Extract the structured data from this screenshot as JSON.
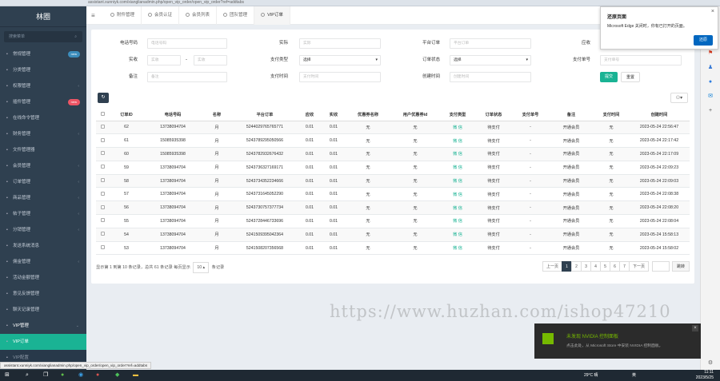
{
  "browser": {
    "address": "assistant.xunniyk.com/xianglianadmin.php/open_vip_order/open_vip_order?ref=addtabs"
  },
  "sidebar": {
    "brand": "林圈",
    "search_placeholder": "搜索菜单",
    "items": [
      {
        "label": "常规管理",
        "badge": "new",
        "badge_color": "#3c8dbc",
        "chev": ""
      },
      {
        "label": "分类管理",
        "badge": "",
        "chev": ""
      },
      {
        "label": "权限管理",
        "badge": "",
        "chev": "‹"
      },
      {
        "label": "插件管理",
        "badge": "new",
        "badge_color": "#ed5565",
        "chev": ""
      },
      {
        "label": "在线命令管理",
        "badge": "",
        "chev": ""
      },
      {
        "label": "财务管理",
        "badge": "",
        "chev": "‹"
      },
      {
        "label": "文件管理器",
        "badge": "",
        "chev": ""
      },
      {
        "label": "会员管理",
        "badge": "",
        "chev": "‹"
      },
      {
        "label": "订单管理",
        "badge": "",
        "chev": "‹"
      },
      {
        "label": "商品管理",
        "badge": "",
        "chev": "‹"
      },
      {
        "label": "帖子管理",
        "badge": "",
        "chev": "‹"
      },
      {
        "label": "分销管理",
        "badge": "",
        "chev": "‹"
      },
      {
        "label": "发送系统消息",
        "badge": "",
        "chev": ""
      },
      {
        "label": "佣金管理",
        "badge": "",
        "chev": "‹"
      },
      {
        "label": "活动金额管理",
        "badge": "",
        "chev": ""
      },
      {
        "label": "意见反馈管理",
        "badge": "",
        "chev": ""
      },
      {
        "label": "聊天记录管理",
        "badge": "",
        "chev": ""
      },
      {
        "label": "VIP管理",
        "badge": "",
        "chev": "⌄",
        "state": "open"
      },
      {
        "label": "VIP订单",
        "badge": "",
        "chev": "",
        "state": "active"
      },
      {
        "label": "VIP配置",
        "badge": "",
        "chev": "",
        "state": "sub"
      }
    ]
  },
  "tabs": [
    {
      "label": "附件管理",
      "active": false
    },
    {
      "label": "会员认证",
      "active": false
    },
    {
      "label": "会员列表",
      "active": false
    },
    {
      "label": "团队管理",
      "active": false
    },
    {
      "label": "VIP订单",
      "active": true
    }
  ],
  "filters": {
    "phone": {
      "label": "电话号码",
      "placeholder": "电话号码"
    },
    "price": {
      "label": "实际",
      "placeholder": "实际"
    },
    "platform_order": {
      "label": "平台订单",
      "placeholder": "平台订单"
    },
    "amount": {
      "label": "应收",
      "placeholder": "应收"
    },
    "paid": {
      "label": "实收",
      "placeholder_from": "实收",
      "placeholder_to": "实收",
      "sep": "-"
    },
    "pay_type": {
      "label": "支付类型",
      "value": "选择"
    },
    "order_status": {
      "label": "订单状态",
      "value": "选择"
    },
    "pay_no": {
      "label": "支付单号",
      "placeholder": "支付单号"
    },
    "remark": {
      "label": "备注",
      "placeholder": "备注"
    },
    "pay_time": {
      "label": "支付时间",
      "placeholder": "支付时间"
    },
    "create_time": {
      "label": "创建时间",
      "placeholder": "创建时间"
    },
    "submit": "提交",
    "reset": "重置"
  },
  "table": {
    "headers": [
      "订单ID",
      "电话号码",
      "名称",
      "平台订单",
      "应收",
      "实收",
      "优惠券名称",
      "用户优惠券id",
      "支付类型",
      "订单状态",
      "支付单号",
      "备注",
      "支付时间",
      "创建时间"
    ],
    "rows": [
      [
        "62",
        "13738094704",
        "月",
        "5244029765765771",
        "0.01",
        "0.01",
        "无",
        "无",
        "微 信",
        "待支付",
        "-",
        "开通会员",
        "无",
        "2023-05-24 22:56:47"
      ],
      [
        "61",
        "15085935398",
        "月",
        "5243789295050566",
        "0.01",
        "0.01",
        "无",
        "无",
        "微 信",
        "待支付",
        "-",
        "开通会员",
        "无",
        "2023-05-24 22:17:42"
      ],
      [
        "60",
        "15085935398",
        "月",
        "5243782932676432",
        "0.01",
        "0.01",
        "无",
        "无",
        "微 信",
        "待支付",
        "-",
        "开通会员",
        "无",
        "2023-05-24 22:17:09"
      ],
      [
        "59",
        "13738094704",
        "月",
        "5243736327169171",
        "0.01",
        "0.01",
        "无",
        "无",
        "微 信",
        "待支付",
        "-",
        "开通会员",
        "无",
        "2023-05-24 22:09:23"
      ],
      [
        "58",
        "13738094704",
        "月",
        "5243734352234666",
        "0.01",
        "0.01",
        "无",
        "无",
        "微 信",
        "待支付",
        "-",
        "开通会员",
        "无",
        "2023-05-24 22:09:03"
      ],
      [
        "57",
        "13738094704",
        "月",
        "5243731645052290",
        "0.01",
        "0.01",
        "无",
        "无",
        "微 信",
        "待支付",
        "-",
        "开通会员",
        "无",
        "2023-05-24 22:08:38"
      ],
      [
        "56",
        "13738094704",
        "月",
        "5243730757377734",
        "0.01",
        "0.01",
        "无",
        "无",
        "微 信",
        "待支付",
        "-",
        "开通会员",
        "无",
        "2023-05-24 22:08:20"
      ],
      [
        "55",
        "13738094704",
        "月",
        "5243728446733696",
        "0.01",
        "0.01",
        "无",
        "无",
        "微 信",
        "待支付",
        "-",
        "开通会员",
        "无",
        "2023-05-24 22:08:04"
      ],
      [
        "54",
        "13738094704",
        "月",
        "5241509395042364",
        "0.01",
        "0.01",
        "无",
        "无",
        "微 信",
        "待支付",
        "-",
        "开通会员",
        "无",
        "2023-05-24 15:58:13"
      ],
      [
        "53",
        "13738094704",
        "月",
        "5241508207356568",
        "0.01",
        "0.01",
        "无",
        "无",
        "微 信",
        "待支付",
        "-",
        "开通会员",
        "无",
        "2023-05-24 15:58:02"
      ]
    ]
  },
  "footer": {
    "summary": "显示第 1 到第 10 条记录，总共 61 条记录 每页显示",
    "page_size": "10 ▴",
    "suffix": "条记录"
  },
  "pager": {
    "prev": "上一页",
    "pages": [
      "1",
      "2",
      "3",
      "4",
      "5",
      "6",
      "7"
    ],
    "next": "下一页",
    "jump": "跳转"
  },
  "edge_popup": {
    "title": "还原页面",
    "message": "Microsoft Edge 关闭时，你有已打开的页面。",
    "button": "还原"
  },
  "nvidia_toast": {
    "title": "未发现 NVIDIA 控制面板",
    "message": "点击此处，从 Microsoft Store 中安装 NVIDIA 控制面板。"
  },
  "watermark": "https://www.huzhan.com/ishop47210",
  "status_url": "assistant.xunniyk.com/xianglianadmin.php/open_vip_order/open_vip_order?ref=addtabs",
  "taskbar": {
    "weather": "29°C 晴",
    "ime": "英",
    "time": "11:11",
    "date": "2023/5/25"
  }
}
